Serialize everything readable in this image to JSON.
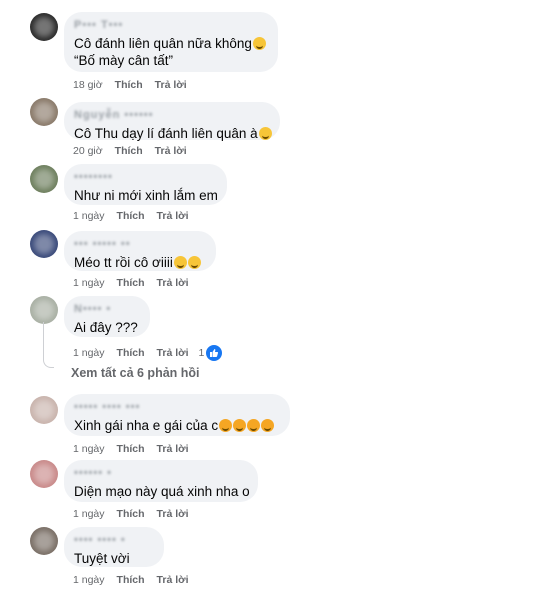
{
  "comments": [
    {
      "name": "P••• T•••",
      "lines": [
        "Cô đánh liên quân nữa không",
        "“Bố mày cân tất”"
      ],
      "emoji_after_line1": "grinning-face",
      "time": "18 giờ",
      "like": "Thích",
      "reply": "Trả lời"
    },
    {
      "name": "Nguyễn ••••••",
      "lines": [
        "Cô Thu dạy lí đánh liên quân à"
      ],
      "emoji_after_line1": "thinking-face",
      "time": "20 giờ",
      "like": "Thích",
      "reply": "Trả lời"
    },
    {
      "name": "••••••••",
      "lines": [
        "Như ni mới xinh lắm em"
      ],
      "time": "1 ngày",
      "like": "Thích",
      "reply": "Trả lời"
    },
    {
      "name": "••• ••••• ••",
      "lines": [
        "Méo tt rồi cô ơiiii"
      ],
      "emoji_after_line1": "laughing-tears",
      "time": "1 ngày",
      "like": "Thích",
      "reply": "Trả lời"
    },
    {
      "name": "N•••• •",
      "lines": [
        "Ai đây ???"
      ],
      "time": "1 ngày",
      "like": "Thích",
      "reply": "Trả lời",
      "reactions": "1"
    },
    {
      "name": "••••• •••• •••",
      "lines": [
        "Xinh gái nha e gái của c"
      ],
      "emoji_after_line1": "kissing-face x4",
      "time": "1 ngày",
      "like": "Thích",
      "reply": "Trả lời"
    },
    {
      "name": "•••••• •",
      "lines": [
        "Diện mạo này quá xinh nha o"
      ],
      "time": "1 ngày",
      "like": "Thích",
      "reply": "Trả lời"
    },
    {
      "name": "•••• •••• •",
      "lines": [
        "Tuyệt vời"
      ],
      "time": "1 ngày",
      "like": "Thích",
      "reply": "Trả lời"
    }
  ],
  "view_replies": "Xem tất cả 6 phản hồi",
  "colors": {
    "bubble": "#f0f2f5",
    "meta": "#65676b",
    "like_blue": "#1877f2"
  }
}
